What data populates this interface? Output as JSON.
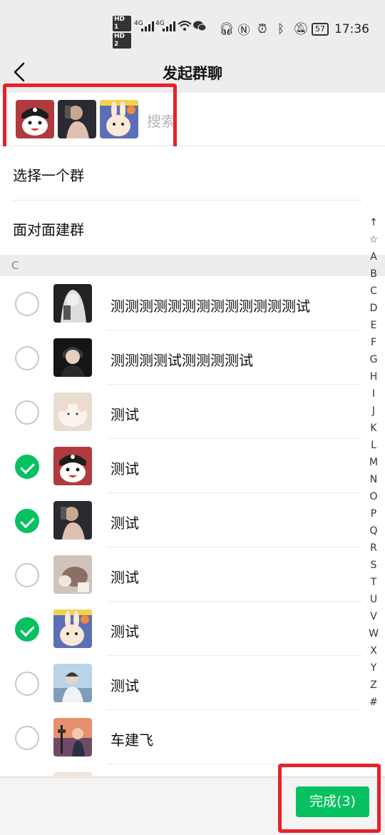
{
  "status_bar": {
    "time": "17:36",
    "battery": "57",
    "hd1": "HD 1",
    "hd2": "HD 2",
    "net1": "4G",
    "net2": "4G"
  },
  "nav": {
    "title": "发起群聊"
  },
  "search": {
    "placeholder": "搜索"
  },
  "menu": {
    "select_group": "选择一个群",
    "face_to_face": "面对面建群"
  },
  "section_letter": "C",
  "contacts": [
    {
      "name": "测测测测测测测测测测测测测试",
      "checked": false
    },
    {
      "name": "测测测测试测测测测试",
      "checked": false
    },
    {
      "name": "测试",
      "checked": false
    },
    {
      "name": "测试",
      "checked": true
    },
    {
      "name": "测试",
      "checked": true
    },
    {
      "name": "测试",
      "checked": false
    },
    {
      "name": "测试",
      "checked": true
    },
    {
      "name": "测试",
      "checked": false
    },
    {
      "name": "车建飞",
      "checked": false
    }
  ],
  "index_letters": [
    "↑",
    "☆",
    "A",
    "B",
    "C",
    "D",
    "E",
    "F",
    "G",
    "H",
    "I",
    "J",
    "K",
    "L",
    "M",
    "N",
    "O",
    "P",
    "Q",
    "R",
    "S",
    "T",
    "U",
    "V",
    "W",
    "X",
    "Y",
    "Z",
    "#"
  ],
  "done_button": {
    "label": "完成(3)"
  },
  "colors": {
    "accent_green": "#07c160",
    "highlight_red": "#e8212a"
  }
}
